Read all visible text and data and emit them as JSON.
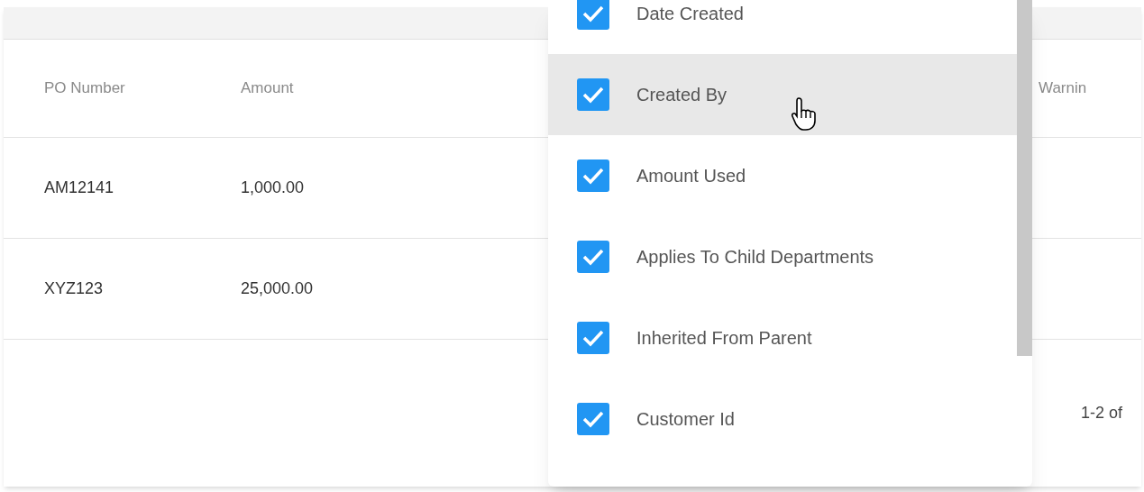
{
  "table": {
    "columns": [
      "PO Number",
      "Amount",
      "Warnin"
    ],
    "rows": [
      [
        "AM12141",
        "1,000.00"
      ],
      [
        "XYZ123",
        "25,000.00"
      ]
    ],
    "pagination": "1-2 of"
  },
  "column_menu": {
    "items": [
      {
        "label": "Date Created",
        "checked": true,
        "hovered": false
      },
      {
        "label": "Created By",
        "checked": true,
        "hovered": true
      },
      {
        "label": "Amount Used",
        "checked": true,
        "hovered": false
      },
      {
        "label": "Applies To Child Departments",
        "checked": true,
        "hovered": false
      },
      {
        "label": "Inherited From Parent",
        "checked": true,
        "hovered": false
      },
      {
        "label": "Customer Id",
        "checked": true,
        "hovered": false
      }
    ]
  }
}
